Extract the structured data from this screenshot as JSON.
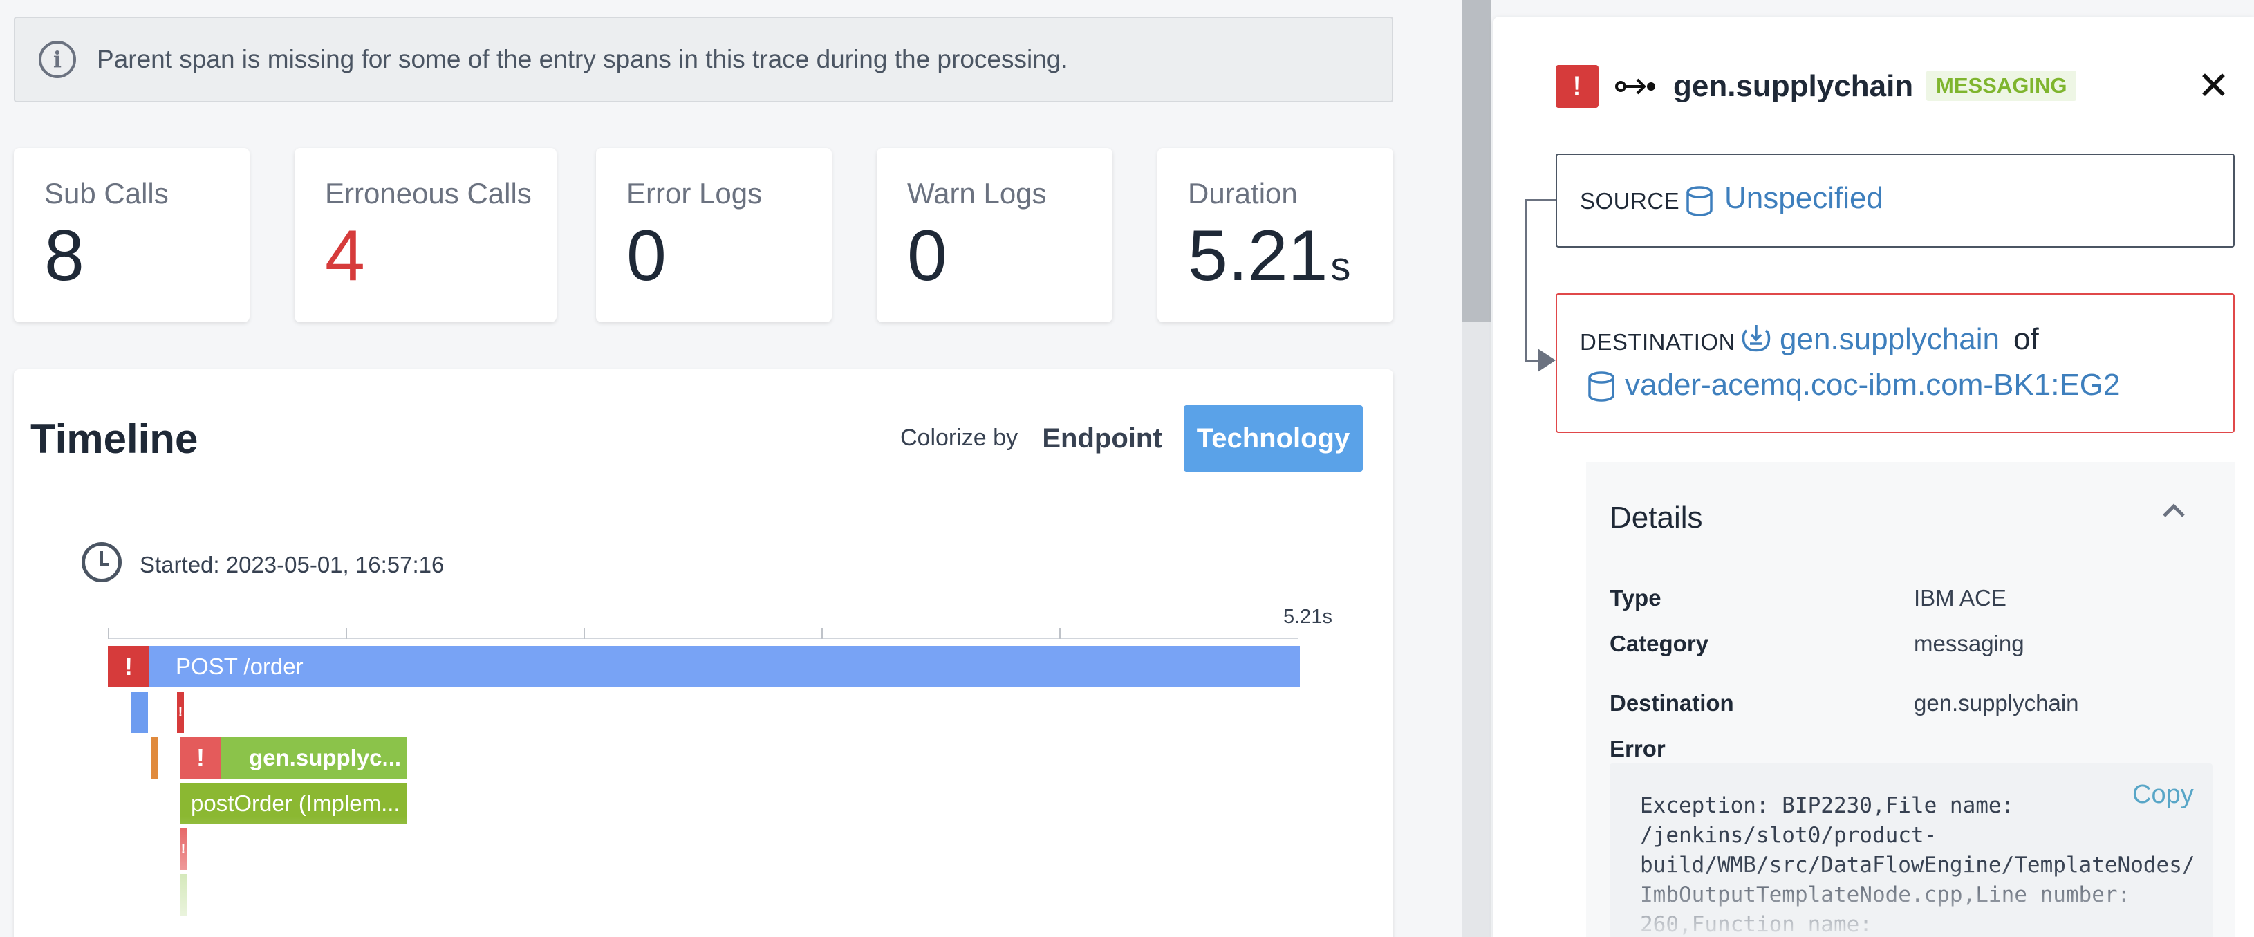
{
  "banner": {
    "icon": "info-circle-icon",
    "text": "Parent span is missing for some of the entry spans in this trace during the processing."
  },
  "metrics": {
    "sub_calls": {
      "label": "Sub Calls",
      "value": "8"
    },
    "erroneous_calls": {
      "label": "Erroneous Calls",
      "value": "4",
      "color": "#d63b3b"
    },
    "error_logs": {
      "label": "Error Logs",
      "value": "0"
    },
    "warn_logs": {
      "label": "Warn Logs",
      "value": "0"
    },
    "duration": {
      "label": "Duration",
      "value": "5.21",
      "unit": "s"
    }
  },
  "timeline": {
    "title": "Timeline",
    "colorize_label": "Colorize by",
    "colorize_options": [
      "Endpoint",
      "Technology"
    ],
    "colorize_selected": "Technology",
    "started": "Started: 2023-05-01, 16:57:16",
    "axis_end_label": "5.21s",
    "spans": [
      {
        "label": "POST /order",
        "error": true,
        "color": "#78a3f5"
      },
      {
        "label": "",
        "error": false,
        "color": "#6d9cf0"
      },
      {
        "label": "",
        "error": true,
        "color": "#d63b3b"
      },
      {
        "label": "",
        "error": false,
        "color": "#e08a3c"
      },
      {
        "label": "gen.supplyc...",
        "error": true,
        "color": "#8bc34a"
      },
      {
        "label": "postOrder (Implem...",
        "error": false,
        "color": "#8bb832"
      },
      {
        "label": "",
        "error": true,
        "color": "#d63b3b"
      },
      {
        "label": "",
        "error": false,
        "color": "#b8d98c"
      }
    ]
  },
  "detail_panel": {
    "error_icon": "exclamation-icon",
    "type_icon": "messaging-arrow-icon",
    "title": "gen.supplychain",
    "badge": "MESSAGING",
    "close_icon": "close-icon",
    "source": {
      "label": "SOURCE",
      "icon": "database-icon",
      "value": "Unspecified"
    },
    "destination": {
      "label": "DESTINATION",
      "icon": "queue-icon",
      "value": "gen.supplychain",
      "of": "of",
      "host_icon": "database-icon",
      "host": "vader-acemq.coc-ibm.com-BK1:EG2"
    },
    "details": {
      "title": "Details",
      "chevron": "chevron-up-icon",
      "rows": [
        {
          "key": "Type",
          "value": "IBM ACE"
        },
        {
          "key": "Category",
          "value": "messaging"
        },
        {
          "key": "Destination",
          "value": "gen.supplychain"
        }
      ],
      "error_label": "Error",
      "copy_label": "Copy",
      "error_text": "Exception: BIP2230,File name:\n/jenkins/slot0/product-\nbuild/WMB/src/DataFlowEngine/TemplateNodes/\nImbOutputTemplateNode.cpp,Line number:\n260,Function name:"
    }
  }
}
